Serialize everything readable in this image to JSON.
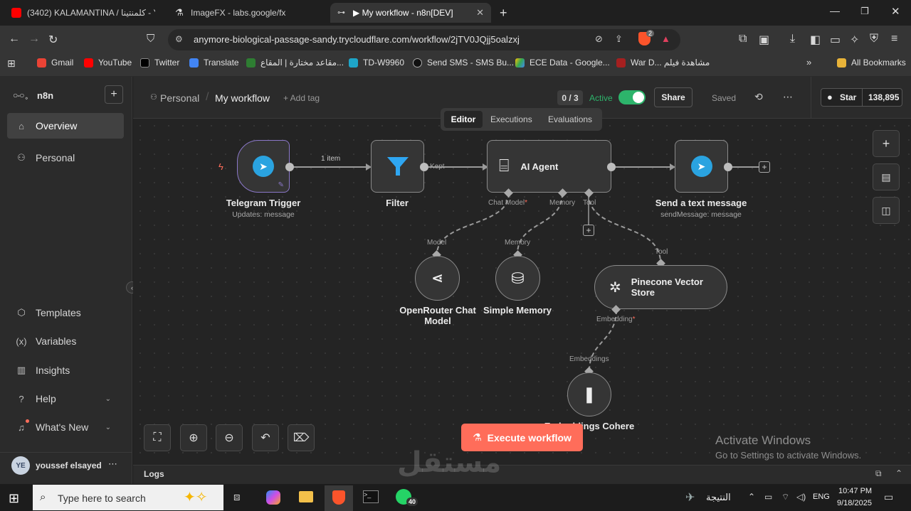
{
  "browser": {
    "tabs": [
      {
        "title": "(3402) KALAMANTINA / كلمنتينا - You",
        "active": false
      },
      {
        "title": "ImageFX - labs.google/fx",
        "active": false
      },
      {
        "title": "▶ My workflow - n8n[DEV]",
        "active": true
      }
    ],
    "url": "anymore-biological-passage-sandy.trycloudflare.com/workflow/2jTV0JQjj5oalzxj",
    "bookmarks": [
      "Gmail",
      "YouTube",
      "Twitter",
      "Translate",
      "مقاعد مختارة | المقاع...",
      "TD-W9960",
      "Send SMS - SMS Bu...",
      "ECE Data - Google...",
      "War D... مشاهدة فيلم",
      "All Bookmarks"
    ],
    "extension_badge": "2"
  },
  "sidebar": {
    "brand": "n8n",
    "items": [
      {
        "label": "Overview",
        "icon": "home-icon",
        "selected": true
      },
      {
        "label": "Personal",
        "icon": "user-icon",
        "selected": false
      }
    ],
    "bottom_items": [
      {
        "label": "Templates",
        "icon": "box-icon"
      },
      {
        "label": "Variables",
        "icon": "variable-icon"
      },
      {
        "label": "Insights",
        "icon": "chart-icon"
      },
      {
        "label": "Help",
        "icon": "help-icon"
      },
      {
        "label": "What's New",
        "icon": "bell-icon"
      }
    ],
    "user": {
      "initials": "YE",
      "name": "youssef elsayed"
    }
  },
  "header": {
    "breadcrumb_project": "Personal",
    "workflow_name": "My workflow",
    "add_tag": "+ Add tag",
    "counter": "0 / 3",
    "active_label": "Active",
    "share_label": "Share",
    "saved_label": "Saved",
    "star_label": "Star",
    "star_count": "138,895"
  },
  "view_tabs": [
    "Editor",
    "Executions",
    "Evaluations"
  ],
  "nodes": {
    "telegram_trigger": {
      "title": "Telegram Trigger",
      "subtitle": "Updates: message"
    },
    "filter": {
      "title": "Filter"
    },
    "ai_agent": {
      "title": "AI Agent"
    },
    "send_message": {
      "title": "Send a text message",
      "subtitle": "sendMessage: message"
    },
    "openrouter": {
      "title": "OpenRouter Chat",
      "title2": "Model"
    },
    "memory": {
      "title": "Simple Memory"
    },
    "pinecone": {
      "title": "Pinecone Vector",
      "title2": "Store"
    },
    "cohere": {
      "title": "Embeddings Cohere"
    }
  },
  "edges": {
    "trigger_to_filter": "1 item",
    "filter_output": "Kept"
  },
  "ports": {
    "chat_model": "Chat Model",
    "memory": "Memory",
    "tool": "Tool",
    "model": "Model",
    "memory_in": "Memory",
    "tool_in": "Tool",
    "embedding": "Embedding",
    "embeddings": "Embeddings"
  },
  "execute_label": "Execute workflow",
  "logs_label": "Logs",
  "watermark": {
    "line1": "Activate Windows",
    "line2": "Go to Settings to activate Windows."
  },
  "taskbar": {
    "search_placeholder": "Type here to search",
    "weather": "النتيجة",
    "lang": "ENG",
    "time": "10:47 PM",
    "date": "9/18/2025",
    "whatsapp_badge": "40"
  },
  "colors": {
    "accent": "#ff6d5a",
    "active_toggle": "#2db46b",
    "telegram": "#2aa3e0"
  }
}
